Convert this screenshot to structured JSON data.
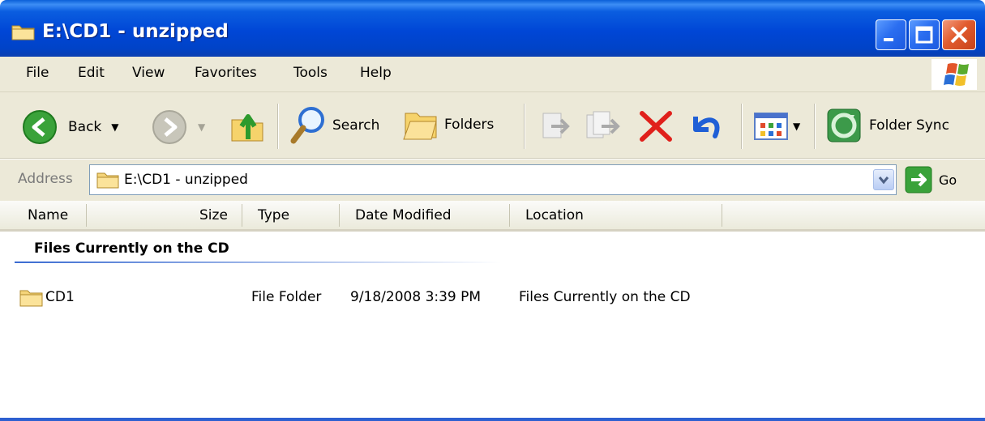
{
  "window": {
    "title": "E:\\CD1 - unzipped"
  },
  "menu": [
    {
      "label": "File"
    },
    {
      "label": "Edit"
    },
    {
      "label": "View"
    },
    {
      "label": "Favorites"
    },
    {
      "label": "Tools"
    },
    {
      "label": "Help"
    }
  ],
  "toolbar": {
    "back_label": "Back",
    "search_label": "Search",
    "folders_label": "Folders",
    "foldersync_label": "Folder Sync"
  },
  "address": {
    "label": "Address",
    "value": "E:\\CD1 - unzipped",
    "go_label": "Go"
  },
  "columns": [
    "Name",
    "Size",
    "Type",
    "Date Modified",
    "Location"
  ],
  "group": {
    "title": "Files Currently on the CD"
  },
  "rows": [
    {
      "name": "CD1",
      "size": "",
      "type": "File Folder",
      "modified": "9/18/2008 3:39 PM",
      "location": "Files Currently on the CD"
    }
  ],
  "icons": {
    "title_folder": "folder-icon",
    "back": "back-arrow-icon",
    "forward": "forward-arrow-icon",
    "up": "folder-up-icon",
    "search": "magnifier-icon",
    "folders": "folders-icon",
    "move_to": "move-to-icon",
    "copy_to": "copy-to-icon",
    "delete": "delete-x-icon",
    "undo": "undo-icon",
    "views": "views-icon",
    "folder_sync": "folder-sync-icon",
    "go": "go-arrow-icon",
    "xp_logo": "windows-logo-icon"
  },
  "colors": {
    "titlebar": "#0046d6",
    "chrome": "#ece9d8",
    "delete": "#e0201b",
    "undo": "#1f5fd6"
  }
}
